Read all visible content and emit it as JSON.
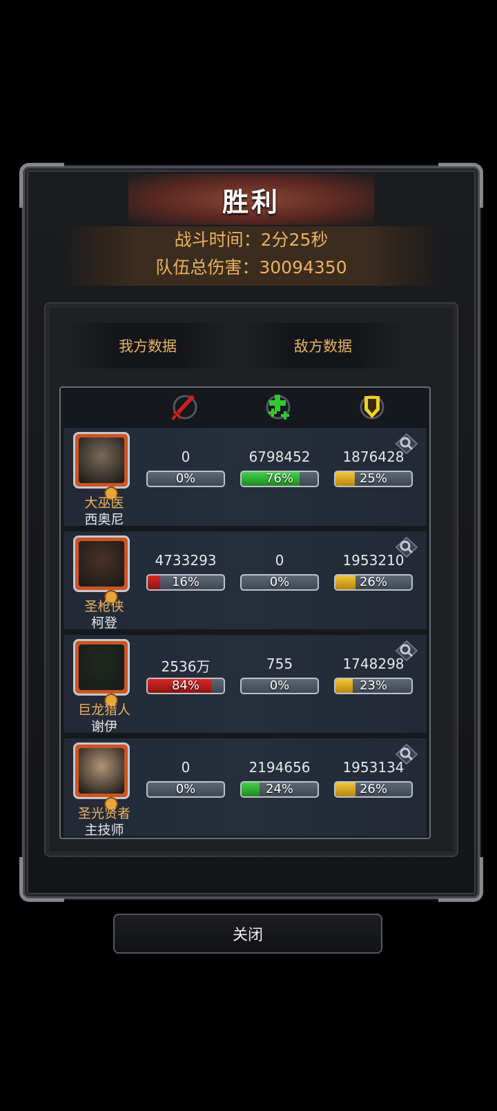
{
  "title": "胜利",
  "summary": {
    "battle_time": "战斗时间：2分25秒",
    "team_damage": "队伍总伤害：30094350"
  },
  "tabs": [
    {
      "label": "我方数据"
    },
    {
      "label": "敌方数据"
    }
  ],
  "columns": [
    {
      "icon": "sword-icon",
      "color": "#d11e1e"
    },
    {
      "icon": "heal-icon",
      "color": "#32c832"
    },
    {
      "icon": "shield-icon",
      "color": "#f2d21f"
    }
  ],
  "heroes": [
    {
      "class": "大巫医",
      "name": "西奥尼",
      "avatar_color": "#7a6a58",
      "damage": {
        "value": "0",
        "percent": "0%",
        "fill": 0
      },
      "healing": {
        "value": "6798452",
        "percent": "76%",
        "fill": 0.76
      },
      "tank": {
        "value": "1876428",
        "percent": "25%",
        "fill": 0.25
      }
    },
    {
      "class": "圣枪侠",
      "name": "柯登",
      "avatar_color": "#4a3224",
      "damage": {
        "value": "4733293",
        "percent": "16%",
        "fill": 0.16
      },
      "healing": {
        "value": "0",
        "percent": "0%",
        "fill": 0
      },
      "tank": {
        "value": "1953210",
        "percent": "26%",
        "fill": 0.26
      }
    },
    {
      "class": "巨龙猎人",
      "name": "谢伊",
      "avatar_color": "#1f2a1f",
      "damage": {
        "value": "2536万",
        "percent": "84%",
        "fill": 0.84
      },
      "healing": {
        "value": "755",
        "percent": "0%",
        "fill": 0
      },
      "tank": {
        "value": "1748298",
        "percent": "23%",
        "fill": 0.23
      }
    },
    {
      "class": "圣光贤者",
      "name": "主技师",
      "avatar_color": "#b39475",
      "damage": {
        "value": "0",
        "percent": "0%",
        "fill": 0
      },
      "healing": {
        "value": "2194656",
        "percent": "24%",
        "fill": 0.24
      },
      "tank": {
        "value": "1953134",
        "percent": "26%",
        "fill": 0.26
      }
    }
  ],
  "close_label": "关闭"
}
